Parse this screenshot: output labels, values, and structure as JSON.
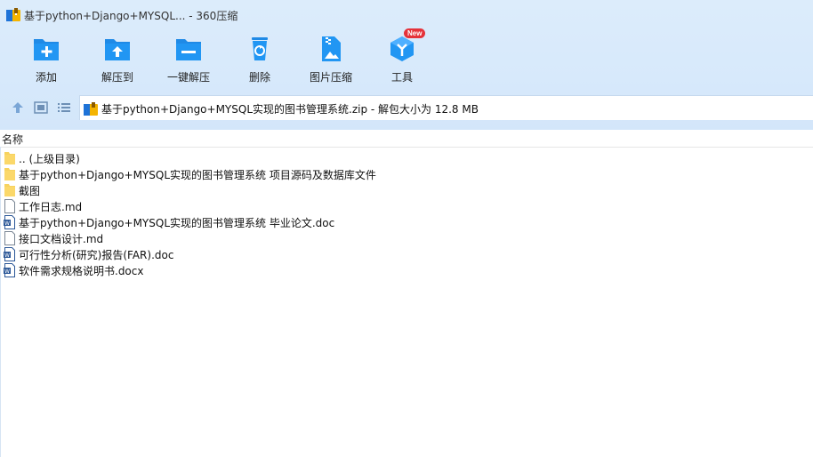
{
  "window": {
    "title": "基于python+Django+MYSQL... - 360压缩"
  },
  "toolbar": {
    "items": [
      {
        "label": "添加",
        "icon": "add-folder-icon"
      },
      {
        "label": "解压到",
        "icon": "extract-folder-icon"
      },
      {
        "label": "一键解压",
        "icon": "one-click-extract-icon"
      },
      {
        "label": "删除",
        "icon": "recycle-bin-icon"
      },
      {
        "label": "图片压缩",
        "icon": "image-compress-icon"
      },
      {
        "label": "工具",
        "icon": "tools-cube-icon",
        "badge": "New"
      }
    ]
  },
  "address": {
    "path": "基于python+Django+MYSQL实现的图书管理系统.zip - 解包大小为 12.8 MB"
  },
  "filelist": {
    "column_name": "名称",
    "rows": [
      {
        "name": ".. (上级目录)",
        "type": "folder"
      },
      {
        "name": "基于python+Django+MYSQL实现的图书管理系统 项目源码及数据库文件",
        "type": "folder"
      },
      {
        "name": "截图",
        "type": "folder"
      },
      {
        "name": "工作日志.md",
        "type": "file"
      },
      {
        "name": "基于python+Django+MYSQL实现的图书管理系统 毕业论文.doc",
        "type": "word"
      },
      {
        "name": "接口文档设计.md",
        "type": "file"
      },
      {
        "name": "可行性分析(研究)报告(FAR).doc",
        "type": "word"
      },
      {
        "name": "软件需求规格说明书.docx",
        "type": "word"
      }
    ]
  },
  "colors": {
    "accent": "#1e88e5",
    "header_bg": "#d7e9fb",
    "badge": "#e5323a"
  }
}
